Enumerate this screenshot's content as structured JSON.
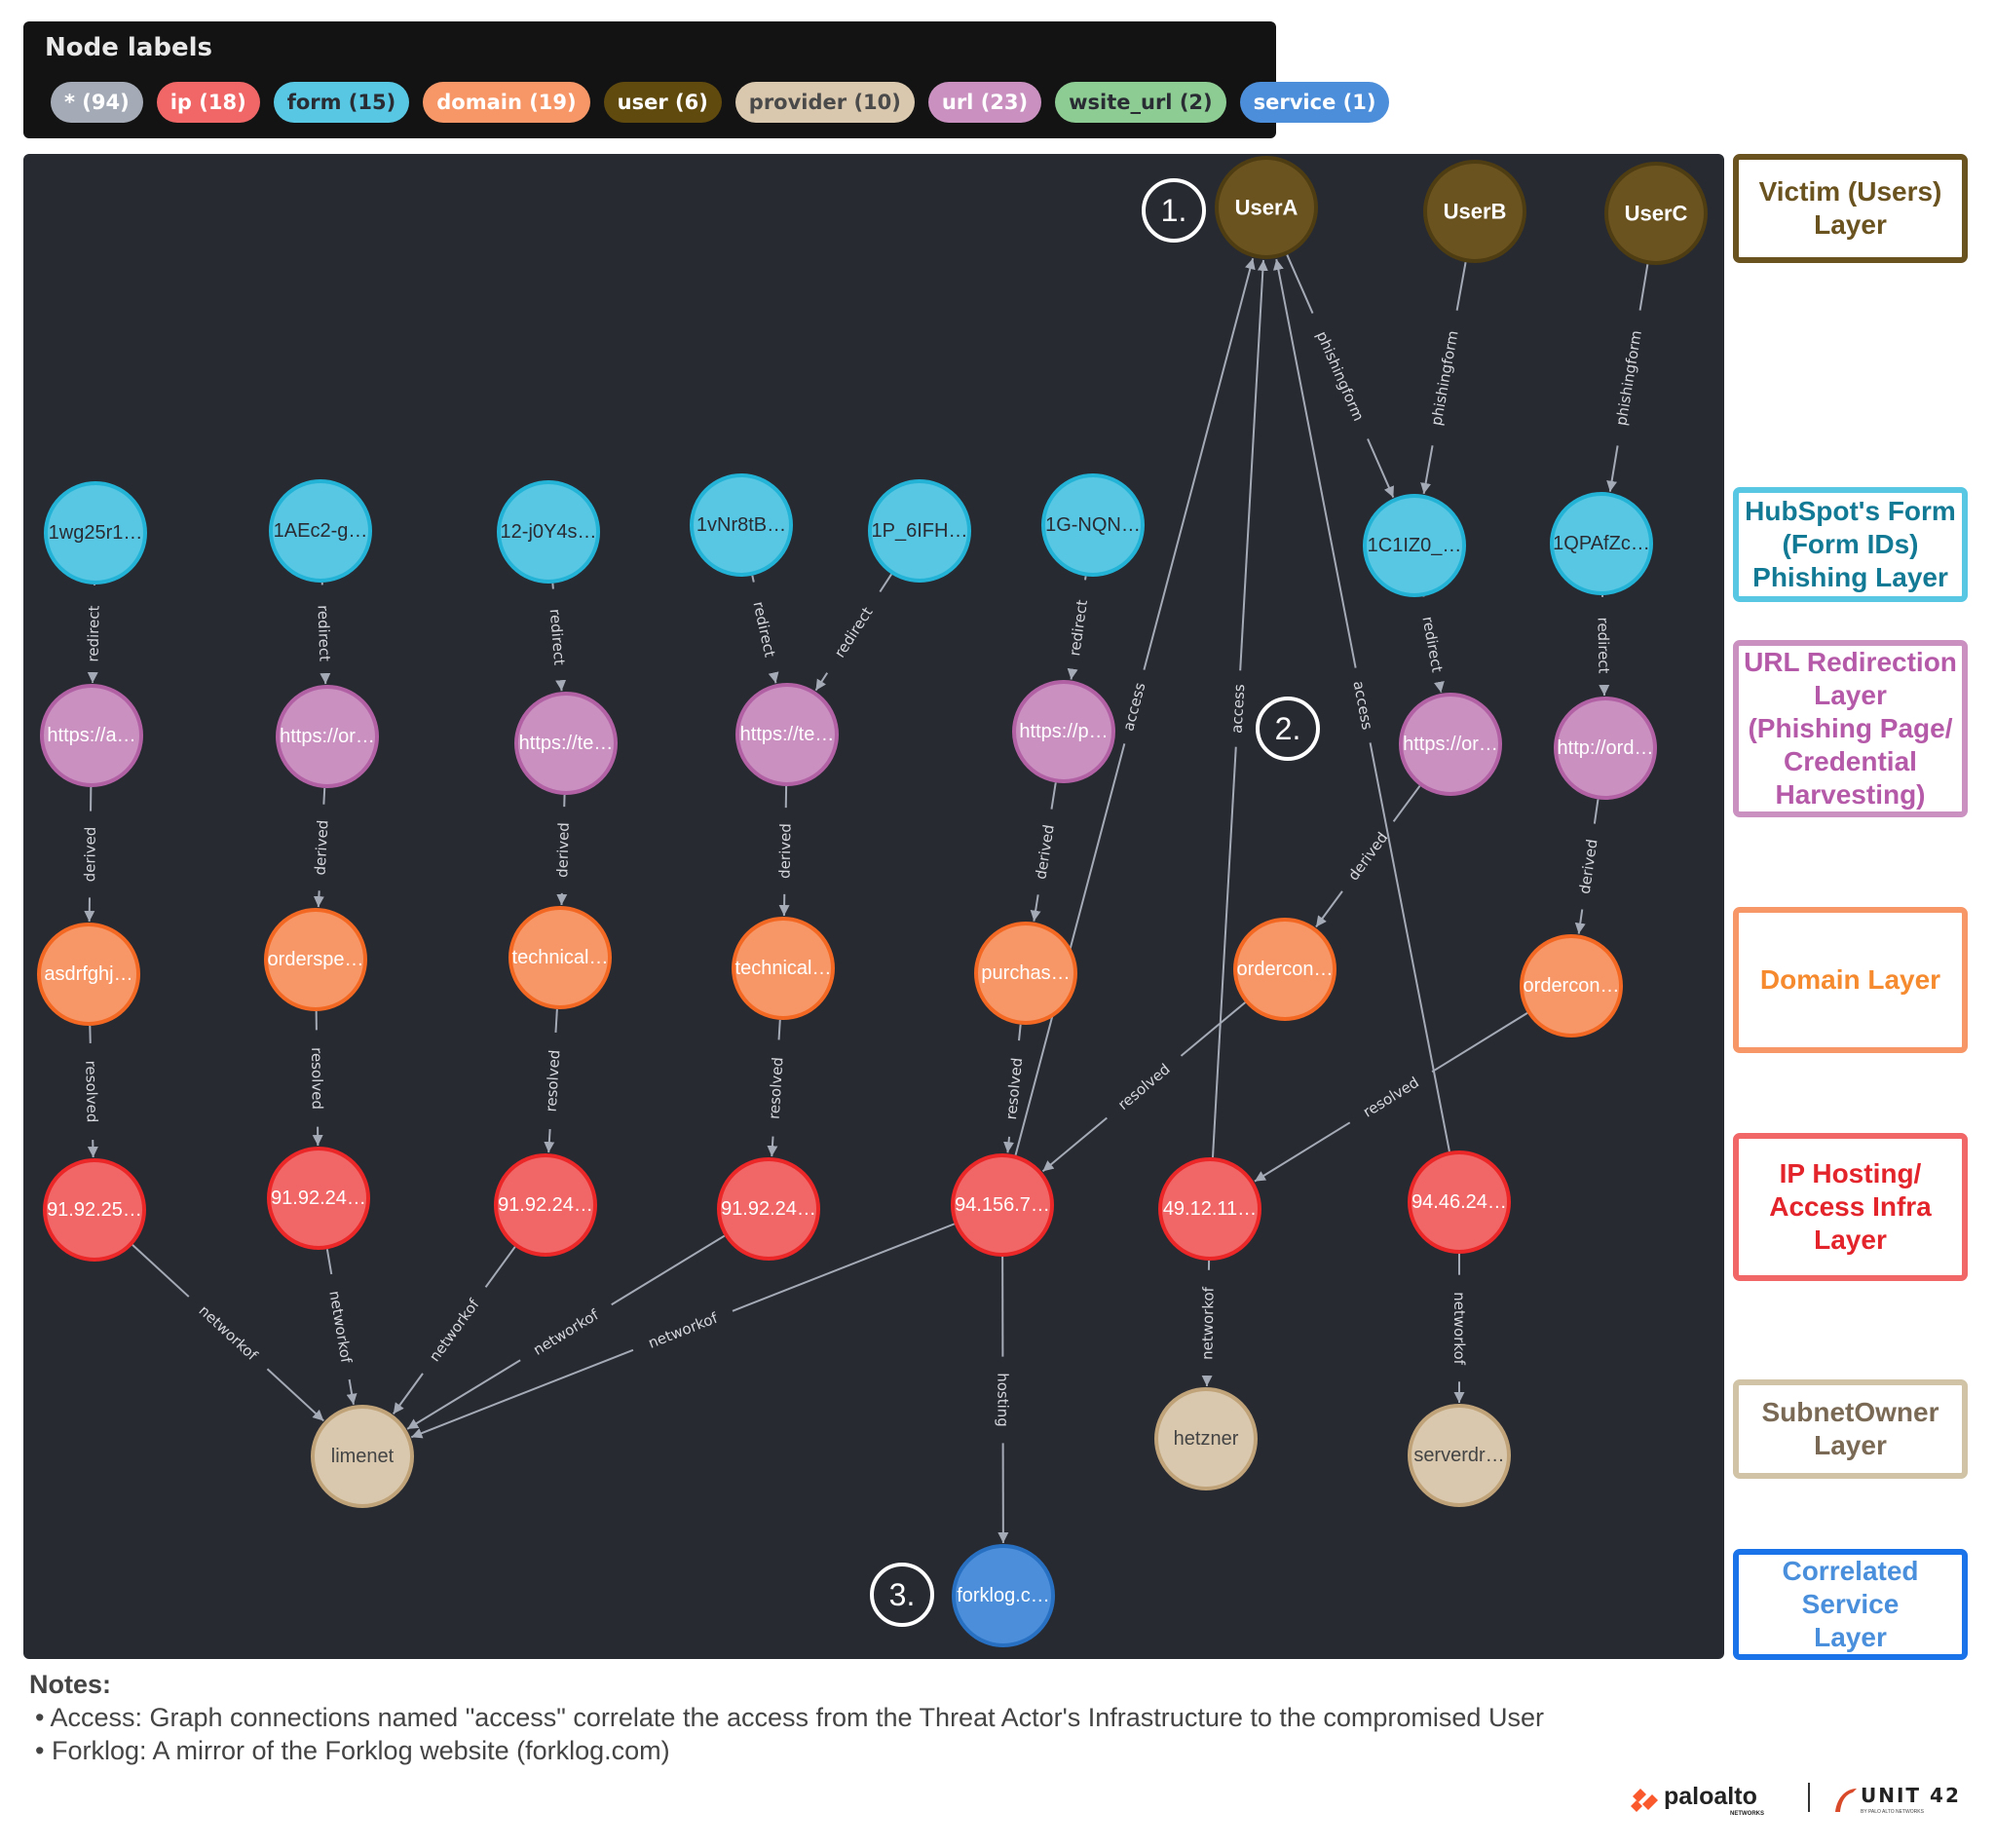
{
  "legend": {
    "title": "Node labels",
    "pills": [
      {
        "label": "* (94)",
        "bg": "#a5abb6",
        "fg": "#ffffff"
      },
      {
        "label": "ip (18)",
        "bg": "#f16667",
        "fg": "#ffffff"
      },
      {
        "label": "form (15)",
        "bg": "#57c7e3",
        "fg": "#2a2c34"
      },
      {
        "label": "domain (19)",
        "bg": "#f79767",
        "fg": "#ffffff"
      },
      {
        "label": "user (6)",
        "bg": "#604a0e",
        "fg": "#ffffff"
      },
      {
        "label": "provider (10)",
        "bg": "#d9c8ae",
        "fg": "#4a4a4a"
      },
      {
        "label": "url (23)",
        "bg": "#c990c0",
        "fg": "#ffffff"
      },
      {
        "label": "wsite_url (2)",
        "bg": "#8dcc93",
        "fg": "#2a2c34"
      },
      {
        "label": "service (1)",
        "bg": "#4c8eda",
        "fg": "#ffffff"
      }
    ]
  },
  "node_types": {
    "user": {
      "fill": "#6b5320",
      "stroke": "#4e3c12",
      "text": "#ffffff",
      "bold": true
    },
    "form": {
      "fill": "#57c7e3",
      "stroke": "#23b3d7",
      "text": "#2a2c34",
      "bold": false
    },
    "url": {
      "fill": "#c990c0",
      "stroke": "#b261a5",
      "text": "#ffffff",
      "bold": false
    },
    "domain": {
      "fill": "#f79767",
      "stroke": "#f36924",
      "text": "#ffffff",
      "bold": false
    },
    "ip": {
      "fill": "#f16667",
      "stroke": "#eb2728",
      "text": "#ffffff",
      "bold": false
    },
    "provider": {
      "fill": "#d9c8ae",
      "stroke": "#c0a378",
      "text": "#444444",
      "bold": false
    },
    "service": {
      "fill": "#4c8eda",
      "stroke": "#2870c2",
      "text": "#ffffff",
      "bold": false
    }
  },
  "graph": {
    "nodes": [
      {
        "id": "userA",
        "type": "user",
        "label": "UserA"
      },
      {
        "id": "userB",
        "type": "user",
        "label": "UserB"
      },
      {
        "id": "userC",
        "type": "user",
        "label": "UserC"
      },
      {
        "id": "f1",
        "type": "form",
        "label": "1wg25r1…"
      },
      {
        "id": "f2",
        "type": "form",
        "label": "1AEc2-g…"
      },
      {
        "id": "f3",
        "type": "form",
        "label": "12-j0Y4s…"
      },
      {
        "id": "f4",
        "type": "form",
        "label": "1vNr8tB…"
      },
      {
        "id": "f5",
        "type": "form",
        "label": "1P_6IFH…"
      },
      {
        "id": "f6",
        "type": "form",
        "label": "1G-NQN…"
      },
      {
        "id": "f7",
        "type": "form",
        "label": "1C1IZ0_…"
      },
      {
        "id": "f8",
        "type": "form",
        "label": "1QPAfZc…"
      },
      {
        "id": "u1",
        "type": "url",
        "label": "https://a…"
      },
      {
        "id": "u2",
        "type": "url",
        "label": "https://or…"
      },
      {
        "id": "u3",
        "type": "url",
        "label": "https://te…"
      },
      {
        "id": "u4",
        "type": "url",
        "label": "https://te…"
      },
      {
        "id": "u5",
        "type": "url",
        "label": "https://p…"
      },
      {
        "id": "u6",
        "type": "url",
        "label": "https://or…"
      },
      {
        "id": "u7",
        "type": "url",
        "label": "http://ord…"
      },
      {
        "id": "d1",
        "type": "domain",
        "label": "asdrfghj…"
      },
      {
        "id": "d2",
        "type": "domain",
        "label": "orderspe…"
      },
      {
        "id": "d3",
        "type": "domain",
        "label": "technical…"
      },
      {
        "id": "d4",
        "type": "domain",
        "label": "technical…"
      },
      {
        "id": "d5",
        "type": "domain",
        "label": "purchas…"
      },
      {
        "id": "d6",
        "type": "domain",
        "label": "ordercon…"
      },
      {
        "id": "d7",
        "type": "domain",
        "label": "ordercon…"
      },
      {
        "id": "i1",
        "type": "ip",
        "label": "91.92.25…"
      },
      {
        "id": "i2",
        "type": "ip",
        "label": "91.92.24…"
      },
      {
        "id": "i3",
        "type": "ip",
        "label": "91.92.24…"
      },
      {
        "id": "i4",
        "type": "ip",
        "label": "91.92.24…"
      },
      {
        "id": "i5",
        "type": "ip",
        "label": "94.156.7…"
      },
      {
        "id": "i6",
        "type": "ip",
        "label": "49.12.11…"
      },
      {
        "id": "i7",
        "type": "ip",
        "label": "94.46.24…"
      },
      {
        "id": "p1",
        "type": "provider",
        "label": "limenet"
      },
      {
        "id": "p2",
        "type": "provider",
        "label": "hetzner"
      },
      {
        "id": "p3",
        "type": "provider",
        "label": "serverdr…"
      },
      {
        "id": "s1",
        "type": "service",
        "label": "forklog.c…"
      }
    ],
    "edges": [
      {
        "from": "userA",
        "to": "f7",
        "label": "phishingform"
      },
      {
        "from": "userB",
        "to": "f7",
        "label": "phishingform"
      },
      {
        "from": "userC",
        "to": "f8",
        "label": "phishingform"
      },
      {
        "from": "f1",
        "to": "u1",
        "label": "redirect"
      },
      {
        "from": "f2",
        "to": "u2",
        "label": "redirect"
      },
      {
        "from": "f3",
        "to": "u3",
        "label": "redirect"
      },
      {
        "from": "f4",
        "to": "u4",
        "label": "redirect"
      },
      {
        "from": "f5",
        "to": "u4",
        "label": "redirect"
      },
      {
        "from": "f6",
        "to": "u5",
        "label": "redirect"
      },
      {
        "from": "f7",
        "to": "u6",
        "label": "redirect"
      },
      {
        "from": "f8",
        "to": "u7",
        "label": "redirect"
      },
      {
        "from": "u1",
        "to": "d1",
        "label": "derived"
      },
      {
        "from": "u2",
        "to": "d2",
        "label": "derived"
      },
      {
        "from": "u3",
        "to": "d3",
        "label": "derived"
      },
      {
        "from": "u4",
        "to": "d4",
        "label": "derived"
      },
      {
        "from": "u5",
        "to": "d5",
        "label": "derived"
      },
      {
        "from": "u6",
        "to": "d6",
        "label": "derived"
      },
      {
        "from": "u7",
        "to": "d7",
        "label": "derived"
      },
      {
        "from": "d1",
        "to": "i1",
        "label": "resolved"
      },
      {
        "from": "d2",
        "to": "i2",
        "label": "resolved"
      },
      {
        "from": "d3",
        "to": "i3",
        "label": "resolved"
      },
      {
        "from": "d4",
        "to": "i4",
        "label": "resolved"
      },
      {
        "from": "d5",
        "to": "i5",
        "label": "resolved"
      },
      {
        "from": "d6",
        "to": "i5",
        "label": "resolved"
      },
      {
        "from": "d7",
        "to": "i6",
        "label": "resolved"
      },
      {
        "from": "i5",
        "to": "userA",
        "label": "access"
      },
      {
        "from": "i6",
        "to": "userA",
        "label": "access"
      },
      {
        "from": "i7",
        "to": "userA",
        "label": "access"
      },
      {
        "from": "i1",
        "to": "p1",
        "label": "networkof"
      },
      {
        "from": "i2",
        "to": "p1",
        "label": "networkof"
      },
      {
        "from": "i3",
        "to": "p1",
        "label": "networkof"
      },
      {
        "from": "i4",
        "to": "p1",
        "label": "networkof"
      },
      {
        "from": "i5",
        "to": "p1",
        "label": "networkof"
      },
      {
        "from": "i6",
        "to": "p2",
        "label": "networkof"
      },
      {
        "from": "i7",
        "to": "p3",
        "label": "networkof"
      },
      {
        "from": "i5",
        "to": "s1",
        "label": "hosting"
      }
    ],
    "markers": [
      {
        "label": "1.",
        "near": "userA"
      },
      {
        "label": "2.",
        "near": "access-edges"
      },
      {
        "label": "3.",
        "near": "s1"
      }
    ]
  },
  "layers": [
    {
      "label": "Victim (Users) Layer",
      "lines": [
        "Victim (Users)",
        "Layer"
      ],
      "border": "#6b5320",
      "color": "#6b5320"
    },
    {
      "label": "HubSpot's Form (Form IDs) Phishing Layer",
      "lines": [
        "HubSpot's Form",
        "(Form IDs)",
        "Phishing Layer"
      ],
      "border": "#57c7e3",
      "color": "#137a96"
    },
    {
      "label": "URL Redirection Layer (Phishing Page/ Credential Harvesting)",
      "lines": [
        "URL Redirection",
        "Layer",
        "(Phishing Page/",
        "Credential",
        "Harvesting)"
      ],
      "border": "#c990c0",
      "color": "#b55aa8"
    },
    {
      "label": "Domain Layer",
      "lines": [
        "Domain Layer"
      ],
      "border": "#f79767",
      "color": "#f58a2e"
    },
    {
      "label": "IP Hosting/ Access Infra Layer",
      "lines": [
        "IP Hosting/",
        "Access Infra",
        "Layer"
      ],
      "border": "#f16667",
      "color": "#e3242b"
    },
    {
      "label": "SubnetOwner Layer",
      "lines": [
        "SubnetOwner",
        "Layer"
      ],
      "border": "#d1c3a5",
      "color": "#7a6a55"
    },
    {
      "label": "Correlated Service Layer",
      "lines": [
        "Correlated",
        "Service",
        "Layer"
      ],
      "border": "#1a73e8",
      "color": "#4a8fdb"
    }
  ],
  "notes": {
    "heading": "Notes:",
    "items": [
      "• Access: Graph connections named  \"access\" correlate the access from the Threat Actor's Infrastructure to the compromised User",
      "• Forklog: A mirror of the Forklog website (forklog.com)"
    ]
  },
  "branding": {
    "paloalto": "paloalto",
    "paloalto_sub": "NETWORKS",
    "unit42": "UNIT 42",
    "unit42_sub": "BY PALO ALTO NETWORKS"
  }
}
